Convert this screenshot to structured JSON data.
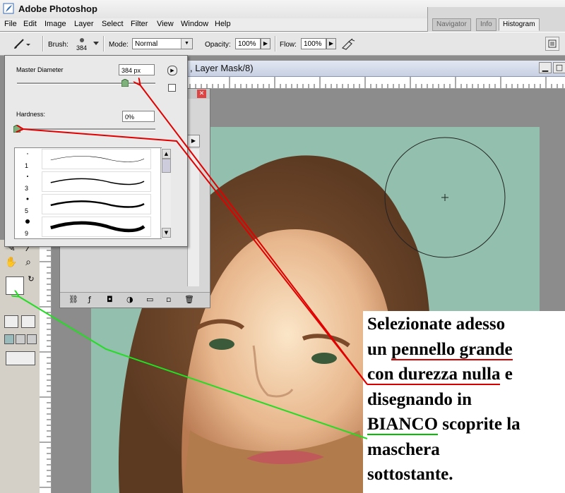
{
  "app": {
    "title": "Adobe Photoshop"
  },
  "menu": {
    "items": [
      "File",
      "Edit",
      "Image",
      "Layer",
      "Select",
      "Filter",
      "View",
      "Window",
      "Help"
    ]
  },
  "palette_well": {
    "tabs": [
      "Navigator",
      "Info",
      "Histogram"
    ],
    "active_tab": "Histogram"
  },
  "options_bar": {
    "brush_label": "Brush:",
    "brush_size": "384",
    "mode_label": "Mode:",
    "mode_value": "Normal",
    "opacity_label": "Opacity:",
    "opacity_value": "100%",
    "flow_label": "Flow:",
    "flow_value": "100%"
  },
  "document": {
    "title": ", Layer Mask/8)"
  },
  "brush_popup": {
    "master_diameter_label": "Master Diameter",
    "master_diameter_value": "384 px",
    "master_diameter_level": 0.78,
    "hardness_label": "Hardness:",
    "hardness_value": "0%",
    "hardness_level": 0.0,
    "presets": [
      {
        "size": "1"
      },
      {
        "size": "3"
      },
      {
        "size": "5"
      },
      {
        "size": "9"
      }
    ]
  },
  "caption": {
    "line1": "Selezionate adesso",
    "line2_pre": "un ",
    "line2_ul": "pennello grande",
    "line3_ul": "con durezza nulla",
    "line3_post": " e",
    "line4": "disegnando in",
    "line5_ul": "BIANCO",
    "line5_post": " scoprite la",
    "line6": "maschera",
    "line7": "sottostante."
  },
  "colors": {
    "arrow_red": "#e00000",
    "arrow_green": "#22dd22",
    "photo_background": "#93c0ae"
  }
}
